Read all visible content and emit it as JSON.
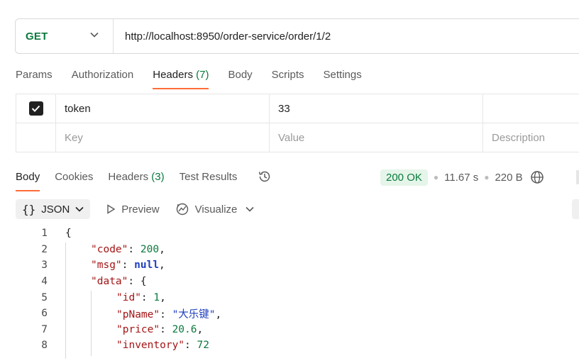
{
  "request": {
    "method": "GET",
    "url": "http://localhost:8950/order-service/order/1/2"
  },
  "request_tabs": {
    "params": "Params",
    "authorization": "Authorization",
    "headers": "Headers",
    "headers_count": "(7)",
    "body": "Body",
    "scripts": "Scripts",
    "settings": "Settings"
  },
  "headers_table": {
    "row": {
      "key": "token",
      "value": "33"
    },
    "placeholder": {
      "key": "Key",
      "value": "Value",
      "description": "Description"
    }
  },
  "response_tabs": {
    "body": "Body",
    "cookies": "Cookies",
    "headers": "Headers",
    "headers_count": "(3)",
    "test_results": "Test Results"
  },
  "status": {
    "code": "200 OK",
    "time": "11.67 s",
    "size": "220 B"
  },
  "toolbar": {
    "format": "JSON",
    "preview": "Preview",
    "visualize": "Visualize"
  },
  "code_lines": {
    "n1": "1",
    "n2": "2",
    "n3": "3",
    "n4": "4",
    "n5": "5",
    "n6": "6",
    "n7": "7",
    "n8": "8",
    "open_brace": "{",
    "code_key": "\"code\"",
    "code_val": "200",
    "msg_key": "\"msg\"",
    "msg_val": "null",
    "data_key": "\"data\"",
    "id_key": "\"id\"",
    "id_val": "1",
    "pname_key": "\"pName\"",
    "pname_val": "\"大乐键\"",
    "price_key": "\"price\"",
    "price_val": "20.6",
    "inventory_key": "\"inventory\"",
    "inventory_val": "72"
  },
  "colors": {
    "accent": "#ff6c37",
    "method_green": "#0a7a3d",
    "json_key": "#a31515",
    "json_string": "#1f3fbf"
  }
}
